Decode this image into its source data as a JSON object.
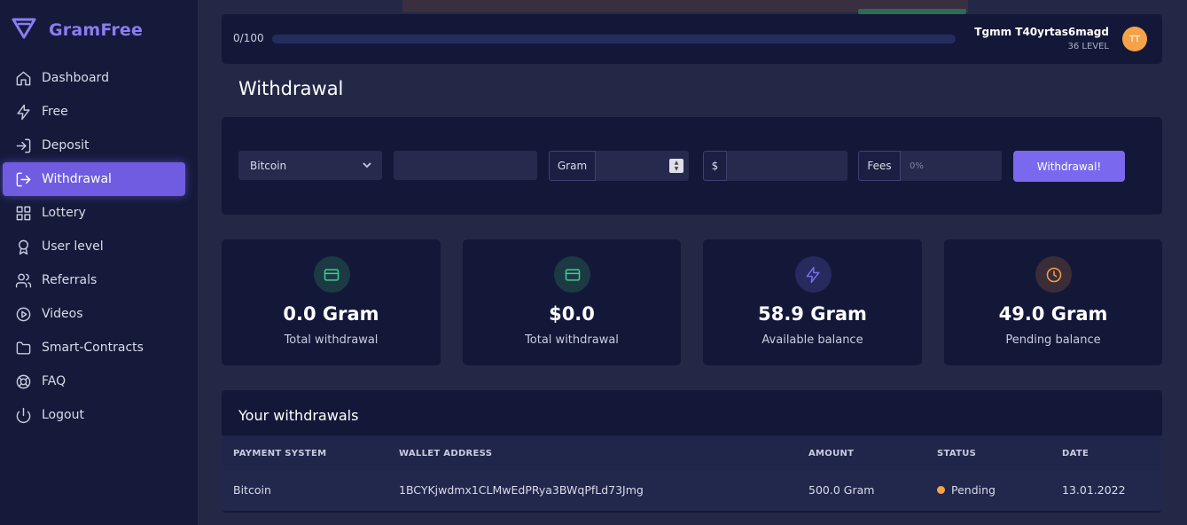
{
  "app": {
    "name": "GramFree",
    "accent": "#7a68ee"
  },
  "sidebar": {
    "items": [
      {
        "label": "Dashboard",
        "icon": "home-icon"
      },
      {
        "label": "Free",
        "icon": "lightning-icon"
      },
      {
        "label": "Deposit",
        "icon": "login-icon"
      },
      {
        "label": "Withdrawal",
        "icon": "logout-arrow-icon",
        "active": true
      },
      {
        "label": "Lottery",
        "icon": "grid-icon"
      },
      {
        "label": "User level",
        "icon": "award-icon"
      },
      {
        "label": "Referrals",
        "icon": "users-icon"
      },
      {
        "label": "Videos",
        "icon": "play-circle-icon"
      },
      {
        "label": "Smart-Contracts",
        "icon": "folder-icon"
      },
      {
        "label": "FAQ",
        "icon": "lifebuoy-icon"
      },
      {
        "label": "Logout",
        "icon": "power-icon"
      }
    ]
  },
  "topbar": {
    "progress_text": "0/100",
    "progress_value": 0,
    "user_name": "Tgmm T40yrtas6magd",
    "user_level": "36 LEVEL",
    "avatar_initials": "TT"
  },
  "page": {
    "title": "Withdrawal"
  },
  "form": {
    "payment_select": "Bitcoin",
    "wallet_value": "",
    "gram_addon": "Gram",
    "gram_value": "",
    "usd_addon": "$",
    "usd_value": "",
    "fees_addon": "Fees",
    "fees_placeholder": "0%",
    "submit_label": "Withdrawal!"
  },
  "stats": [
    {
      "value": "0.0 Gram",
      "label": "Total withdrawal",
      "icon": "card-icon",
      "color": "#3ecf8e"
    },
    {
      "value": "$0.0",
      "label": "Total withdrawal",
      "icon": "card-icon",
      "color": "#3ecf8e"
    },
    {
      "value": "58.9 Gram",
      "label": "Available balance",
      "icon": "lightning-icon",
      "color": "#6f5ce0"
    },
    {
      "value": "49.0 Gram",
      "label": "Pending balance",
      "icon": "clock-icon",
      "color": "#f6a248"
    }
  ],
  "withdrawals": {
    "title": "Your withdrawals",
    "columns": [
      "PAYMENT SYSTEM",
      "WALLET ADDRESS",
      "AMOUNT",
      "STATUS",
      "DATE"
    ],
    "rows": [
      {
        "payment_system": "Bitcoin",
        "wallet_address": "1BCYKjwdmx1CLMwEdPRya3BWqPfLd73Jmg",
        "amount": "500.0 Gram",
        "status": "Pending",
        "status_color": "#f6a248",
        "date": "13.01.2022"
      }
    ]
  }
}
